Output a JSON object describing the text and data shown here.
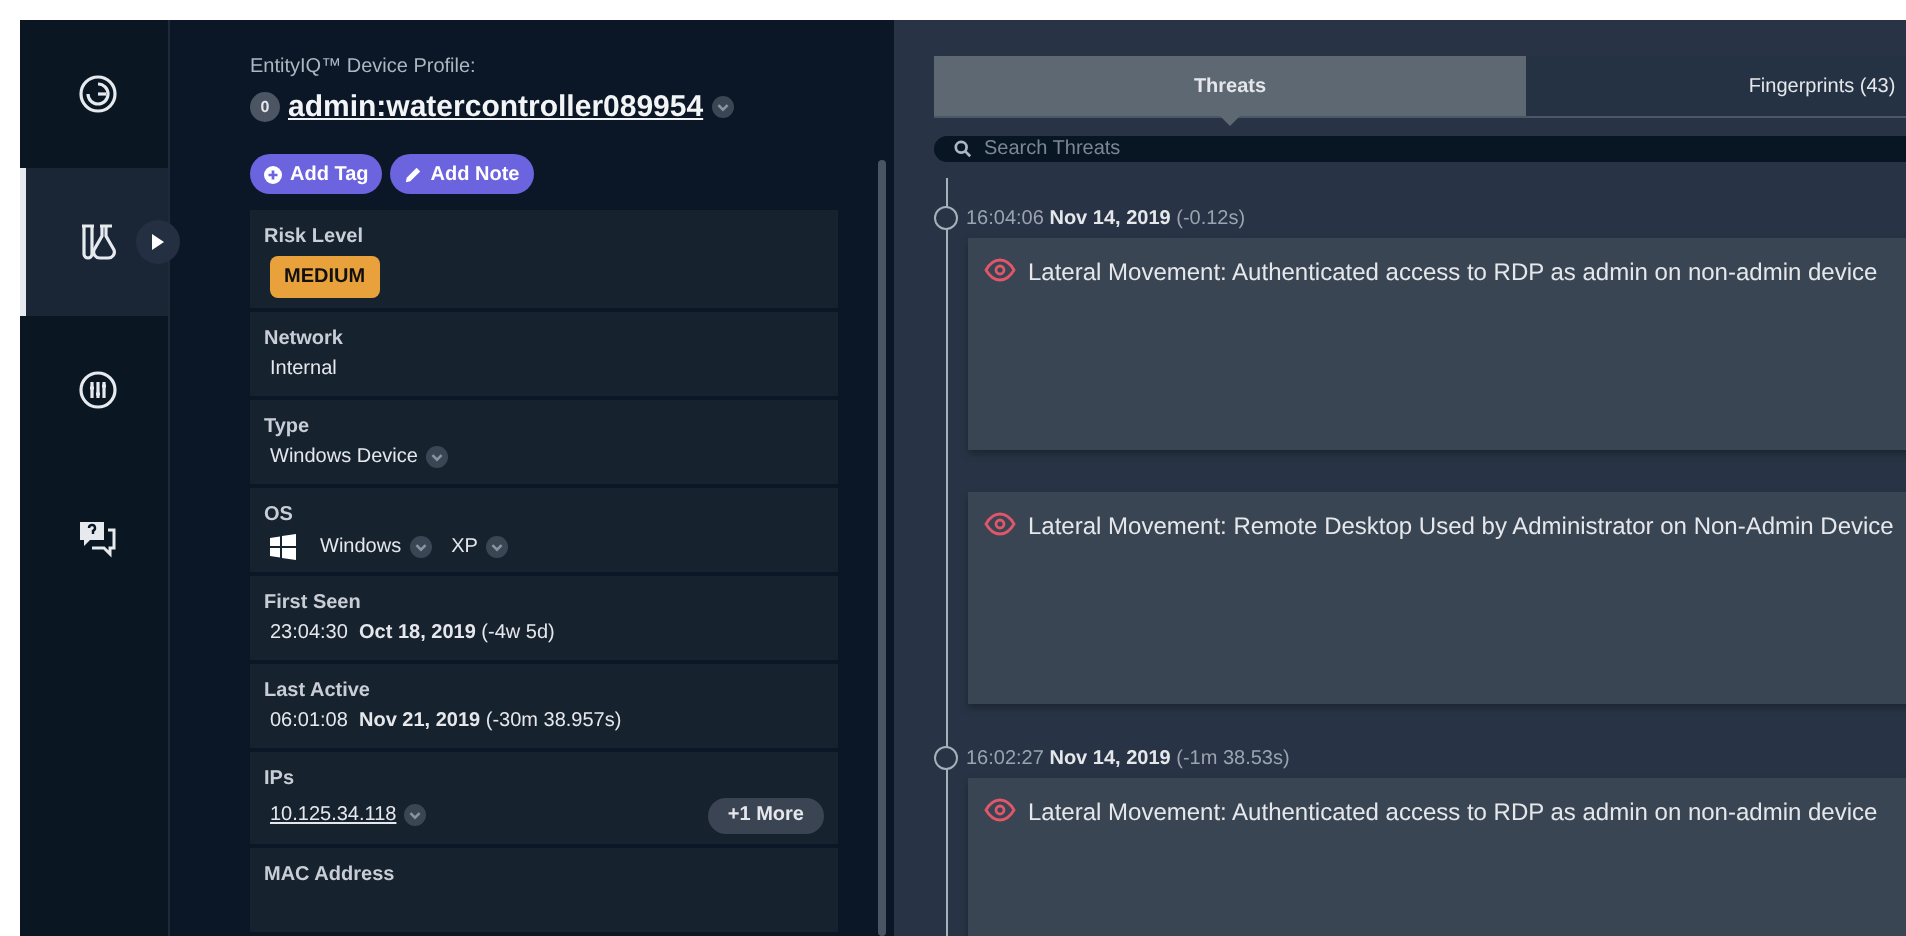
{
  "nav": [
    {
      "kind": "gauge",
      "selected": false
    },
    {
      "kind": "lab",
      "selected": true
    },
    {
      "kind": "sliders",
      "selected": false
    },
    {
      "kind": "chat",
      "selected": false
    }
  ],
  "profile": {
    "caption": "EntityIQ™ Device Profile:",
    "badge": "0",
    "name": "admin:watercontroller089954",
    "actions": [
      {
        "kind": "tag",
        "label": "Add Tag"
      },
      {
        "kind": "note",
        "label": "Add Note"
      }
    ],
    "fields": [
      {
        "kind": "badge",
        "label": "Risk Level",
        "value": "MEDIUM",
        "color": "#e9a23b"
      },
      {
        "kind": "text",
        "label": "Network",
        "value": "Internal"
      },
      {
        "kind": "dropdown",
        "label": "Type",
        "value": "Windows Device"
      },
      {
        "kind": "os",
        "label": "OS",
        "value": "Windows",
        "version": "XP"
      },
      {
        "kind": "datetime",
        "label": "First Seen",
        "time": "23:04:30",
        "date": "Oct 18, 2019",
        "delta": "(-4w 5d)"
      },
      {
        "kind": "datetime",
        "label": "Last Active",
        "time": "06:01:08",
        "date": "Nov 21, 2019",
        "delta": "(-30m 38.957s)"
      },
      {
        "kind": "ip",
        "label": "IPs",
        "value": "10.125.34.118",
        "more": "+1 More"
      },
      {
        "kind": "cut",
        "label": "MAC Address"
      }
    ]
  },
  "tabs": [
    {
      "label": "Threats",
      "selected": true
    },
    {
      "label": "Fingerprints (43)",
      "selected": false
    }
  ],
  "search": {
    "placeholder": "Search Threats"
  },
  "timeline": [
    {
      "time": "16:04:06",
      "date": "Nov 14, 2019",
      "delta": "(-0.12s)",
      "threats": [
        {
          "title": "Lateral Movement: Authenticated access to RDP as admin on non-admin device"
        },
        {
          "title": "Lateral Movement: Remote Desktop Used by Administrator on Non-Admin Device"
        }
      ]
    },
    {
      "time": "16:02:27",
      "date": "Nov 14, 2019",
      "delta": "(-1m 38.53s)",
      "threats": [
        {
          "title": "Lateral Movement: Authenticated access to RDP as admin on non-admin device"
        }
      ]
    }
  ]
}
